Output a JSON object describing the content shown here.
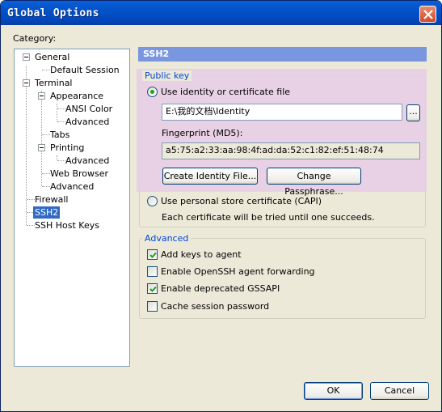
{
  "window": {
    "title": "Global Options"
  },
  "category": {
    "label": "Category:",
    "tree": {
      "general": "General",
      "default_session": "Default Session",
      "terminal": "Terminal",
      "appearance": "Appearance",
      "ansi_color": "ANSI Color",
      "appearance_advanced": "Advanced",
      "tabs": "Tabs",
      "printing": "Printing",
      "printing_advanced": "Advanced",
      "web_browser": "Web Browser",
      "terminal_advanced": "Advanced",
      "firewall": "Firewall",
      "ssh2": "SSH2",
      "ssh_host_keys": "SSH Host Keys"
    },
    "selected": "SSH2"
  },
  "panel": {
    "header": "SSH2",
    "public_key": {
      "title": "Public key",
      "use_identity_label": "Use identity or certificate file",
      "identity_path": "E:\\我的文档\\Identity",
      "browse_label": "...",
      "fingerprint_label": "Fingerprint (MD5):",
      "fingerprint_value": "a5:75:a2:33:aa:98:4f:ad:da:52:c1:82:ef:51:48:74",
      "create_identity_label": "Create Identity File...",
      "change_passphrase_label": "Change Passphrase...",
      "use_capi_label": "Use personal store certificate (CAPI)",
      "capi_note": "Each certificate will be tried until one succeeds."
    },
    "advanced": {
      "title": "Advanced",
      "add_keys": {
        "label": "Add keys to agent",
        "checked": true
      },
      "openssh_forwarding": {
        "label": "Enable OpenSSH agent forwarding",
        "checked": false
      },
      "deprecated_gssapi": {
        "label": "Enable deprecated GSSAPI",
        "checked": true
      },
      "cache_password": {
        "label": "Cache session password",
        "checked": false
      }
    }
  },
  "footer": {
    "ok_label": "OK",
    "cancel_label": "Cancel"
  }
}
